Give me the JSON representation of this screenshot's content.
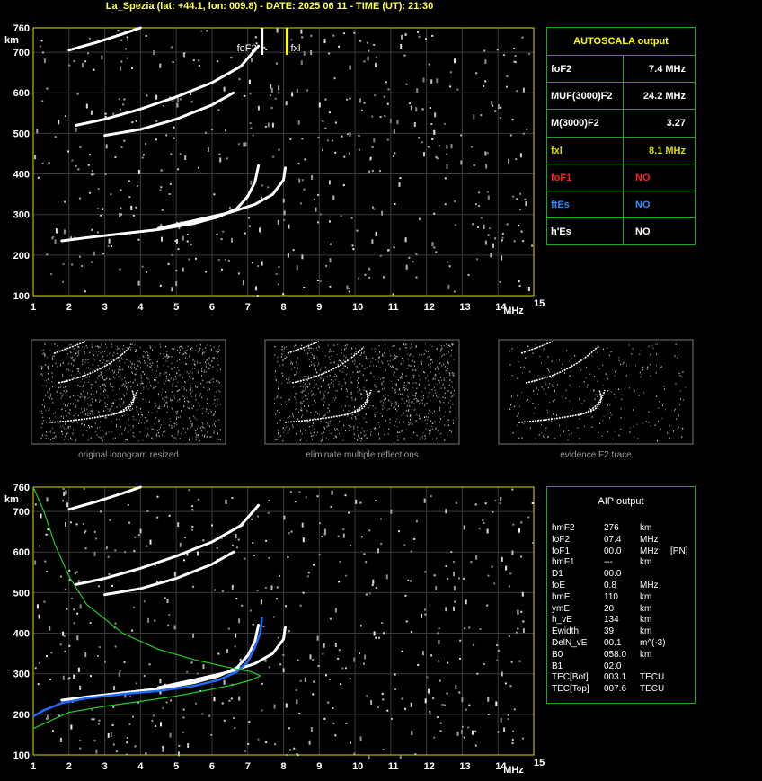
{
  "header": {
    "title": "La_Spezia (lat: +44.1, lon: 009.8) - DATE: 2025 06 11 - TIME (UT): 21:30"
  },
  "colors": {
    "grid": "#3a3a3a",
    "axis": "#dcdc00",
    "frame": "#1fa51f",
    "label_yellow": "#ffff00",
    "red": "#ff0000",
    "blue": "#1e6cff",
    "green": "#22cc22",
    "trace": "#ffffff",
    "fxl_marker": "#ffff00",
    "fof2_marker": "#ffffff"
  },
  "chart_data": [
    {
      "type": "scatter",
      "name_id": "ionogram-top",
      "xlabel": "MHz",
      "ylabel": "km",
      "xlim": [
        1,
        15
      ],
      "ylim": [
        100,
        760
      ],
      "xticks": [
        "1",
        "2",
        "3",
        "4",
        "5",
        "6",
        "7",
        "8",
        "9",
        "10",
        "11",
        "12",
        "13",
        "14",
        "15"
      ],
      "yticks": [
        "100",
        "200",
        "300",
        "400",
        "500",
        "600",
        "700",
        "760"
      ],
      "grid": true,
      "markers": [
        {
          "label": "foF2",
          "x": 7.4
        },
        {
          "label": "fxl",
          "x": 8.1
        }
      ],
      "traces": [
        {
          "id": "f2-o",
          "points": [
            [
              1.8,
              235
            ],
            [
              2.5,
              243
            ],
            [
              3.5,
              253
            ],
            [
              4.5,
              263
            ],
            [
              5.5,
              278
            ],
            [
              6.2,
              295
            ],
            [
              6.7,
              315
            ],
            [
              7.0,
              345
            ],
            [
              7.2,
              380
            ],
            [
              7.3,
              420
            ]
          ]
        },
        {
          "id": "f2-x",
          "points": [
            [
              4.5,
              266
            ],
            [
              5.5,
              285
            ],
            [
              6.5,
              305
            ],
            [
              7.2,
              325
            ],
            [
              7.7,
              350
            ],
            [
              8.0,
              385
            ],
            [
              8.05,
              415
            ]
          ]
        },
        {
          "id": "f2-2hop-o",
          "points": [
            [
              2.2,
              520
            ],
            [
              3.0,
              535
            ],
            [
              4.0,
              560
            ],
            [
              5.0,
              590
            ],
            [
              6.0,
              625
            ],
            [
              6.8,
              665
            ],
            [
              7.3,
              715
            ]
          ]
        },
        {
          "id": "f2-2hop-x",
          "points": [
            [
              3.0,
              495
            ],
            [
              4.0,
              510
            ],
            [
              5.0,
              535
            ],
            [
              6.0,
              570
            ],
            [
              6.6,
              600
            ]
          ]
        },
        {
          "id": "f2-3hop",
          "points": [
            [
              2.0,
              705
            ],
            [
              2.8,
              725
            ],
            [
              3.5,
              745
            ],
            [
              4.0,
              760
            ]
          ]
        }
      ]
    },
    {
      "type": "scatter",
      "name_id": "ionogram-aip",
      "xlabel": "MHz",
      "ylabel": "km",
      "xlim": [
        1,
        15
      ],
      "ylim": [
        100,
        760
      ],
      "xticks": [
        "1",
        "2",
        "3",
        "4",
        "5",
        "6",
        "7",
        "8",
        "9",
        "10",
        "11",
        "12",
        "13",
        "14",
        "15"
      ],
      "yticks": [
        "100",
        "200",
        "300",
        "400",
        "500",
        "600",
        "700",
        "760"
      ],
      "grid": true,
      "traces": [
        {
          "id": "f2-o",
          "points": [
            [
              1.8,
              235
            ],
            [
              2.5,
              243
            ],
            [
              3.5,
              253
            ],
            [
              4.5,
              263
            ],
            [
              5.5,
              278
            ],
            [
              6.2,
              295
            ],
            [
              6.7,
              315
            ],
            [
              7.0,
              345
            ],
            [
              7.2,
              380
            ],
            [
              7.3,
              420
            ]
          ]
        },
        {
          "id": "f2-x",
          "points": [
            [
              4.5,
              266
            ],
            [
              5.5,
              285
            ],
            [
              6.5,
              305
            ],
            [
              7.2,
              325
            ],
            [
              7.7,
              350
            ],
            [
              8.0,
              385
            ],
            [
              8.05,
              415
            ]
          ]
        },
        {
          "id": "f2-2hop-o",
          "points": [
            [
              2.2,
              520
            ],
            [
              3.0,
              535
            ],
            [
              4.0,
              560
            ],
            [
              5.0,
              590
            ],
            [
              6.0,
              625
            ],
            [
              6.8,
              665
            ],
            [
              7.3,
              715
            ]
          ]
        },
        {
          "id": "f2-2hop-x",
          "points": [
            [
              3.0,
              495
            ],
            [
              4.0,
              510
            ],
            [
              5.0,
              535
            ],
            [
              6.0,
              570
            ],
            [
              6.6,
              600
            ]
          ]
        },
        {
          "id": "f2-3hop",
          "points": [
            [
              2.0,
              705
            ],
            [
              2.8,
              725
            ],
            [
              3.5,
              745
            ],
            [
              4.0,
              760
            ]
          ]
        }
      ],
      "fit_curves": [
        {
          "id": "aip-blue-fit",
          "color": "blue",
          "points": [
            [
              1.0,
              195
            ],
            [
              1.3,
              210
            ],
            [
              1.8,
              228
            ],
            [
              2.5,
              240
            ],
            [
              3.5,
              250
            ],
            [
              4.5,
              258
            ],
            [
              5.5,
              270
            ],
            [
              6.2,
              285
            ],
            [
              6.7,
              305
            ],
            [
              7.0,
              330
            ],
            [
              7.2,
              365
            ],
            [
              7.35,
              400
            ],
            [
              7.4,
              440
            ]
          ]
        },
        {
          "id": "aip-green-lower",
          "color": "green",
          "points": [
            [
              1.0,
              165
            ],
            [
              1.5,
              185
            ],
            [
              2.0,
              205
            ],
            [
              3.0,
              220
            ],
            [
              4.0,
              232
            ],
            [
              5.0,
              245
            ],
            [
              6.0,
              262
            ],
            [
              6.7,
              275
            ],
            [
              7.1,
              285
            ],
            [
              7.35,
              295
            ],
            [
              7.1,
              305
            ],
            [
              6.5,
              315
            ],
            [
              5.5,
              335
            ],
            [
              4.5,
              360
            ],
            [
              3.5,
              400
            ],
            [
              2.5,
              470
            ],
            [
              2.0,
              540
            ],
            [
              1.6,
              620
            ],
            [
              1.3,
              700
            ],
            [
              1.0,
              760
            ]
          ]
        }
      ]
    }
  ],
  "autoscala": {
    "title": "AUTOSCALA output",
    "rows": [
      {
        "key": "foF2",
        "value": "7.4 MHz",
        "color": "#ffffff"
      },
      {
        "key": "MUF(3000)F2",
        "value": "24.2 MHz",
        "color": "#ffffff"
      },
      {
        "key": "M(3000)F2",
        "value": "3.27",
        "color": "#ffffff"
      },
      {
        "key": "fxl",
        "value": "8.1 MHz",
        "color": "#dcdc00"
      },
      {
        "key": "foF1",
        "value": "NO",
        "color": "#ff2020"
      },
      {
        "key": "ftEs",
        "value": "NO",
        "color": "#2a8cff"
      },
      {
        "key": "h'Es",
        "value": "NO",
        "color": "#ffffff"
      }
    ]
  },
  "thumbnails": [
    {
      "caption": "original ionogram resized"
    },
    {
      "caption": "eliminate multiple reflections"
    },
    {
      "caption": "evidence F2 trace"
    }
  ],
  "aip": {
    "title": "AIP output",
    "rows": [
      {
        "k": "hmF2",
        "v": "276",
        "u": "km",
        "e": ""
      },
      {
        "k": "foF2",
        "v": "07.4",
        "u": "MHz",
        "e": ""
      },
      {
        "k": "foF1",
        "v": "00.0",
        "u": "MHz",
        "e": "[PN]"
      },
      {
        "k": "hmF1",
        "v": "---",
        "u": "km",
        "e": ""
      },
      {
        "k": "D1",
        "v": "00.0",
        "u": "",
        "e": ""
      },
      {
        "k": "foE",
        "v": "0.8",
        "u": "MHz",
        "e": ""
      },
      {
        "k": "hmE",
        "v": "110",
        "u": "km",
        "e": ""
      },
      {
        "k": "ymE",
        "v": "20",
        "u": "km",
        "e": ""
      },
      {
        "k": "h_vE",
        "v": "134",
        "u": "km",
        "e": ""
      },
      {
        "k": "Ewidth",
        "v": "39",
        "u": "km",
        "e": ""
      },
      {
        "k": "DelN_vE",
        "v": "00.1",
        "u": "m^(-3)",
        "e": ""
      },
      {
        "k": "B0",
        "v": "058.0",
        "u": "km",
        "e": ""
      },
      {
        "k": "B1",
        "v": "02.0",
        "u": "",
        "e": ""
      },
      {
        "k": "TEC[Bot]",
        "v": "003.1",
        "u": "TECU",
        "e": ""
      },
      {
        "k": "TEC[Top]",
        "v": "007.6",
        "u": "TECU",
        "e": ""
      }
    ]
  }
}
